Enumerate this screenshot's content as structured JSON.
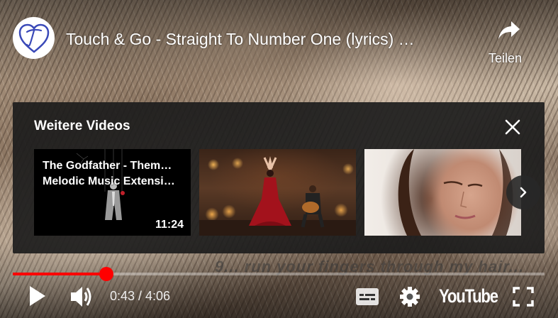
{
  "header": {
    "title": "Touch & Go - Straight To Number One (lyrics) …",
    "share_label": "Teilen",
    "avatar_icon": "heart-t-logo"
  },
  "more_videos": {
    "title": "Weitere Videos",
    "items": [
      {
        "line1": "The Godfather - Them…",
        "line2": "Melodic Music Extensi…",
        "duration": "11:24"
      },
      {
        "line1": "",
        "line2": "",
        "duration": ""
      },
      {
        "line1": "",
        "line2": "",
        "duration": ""
      }
    ]
  },
  "lyric": "9... run your fingers through my hair...",
  "player": {
    "progress_fraction": 0.176,
    "time": "0:43 / 4:06",
    "youtube_label": "YouTube",
    "accent": "#ff0000"
  }
}
